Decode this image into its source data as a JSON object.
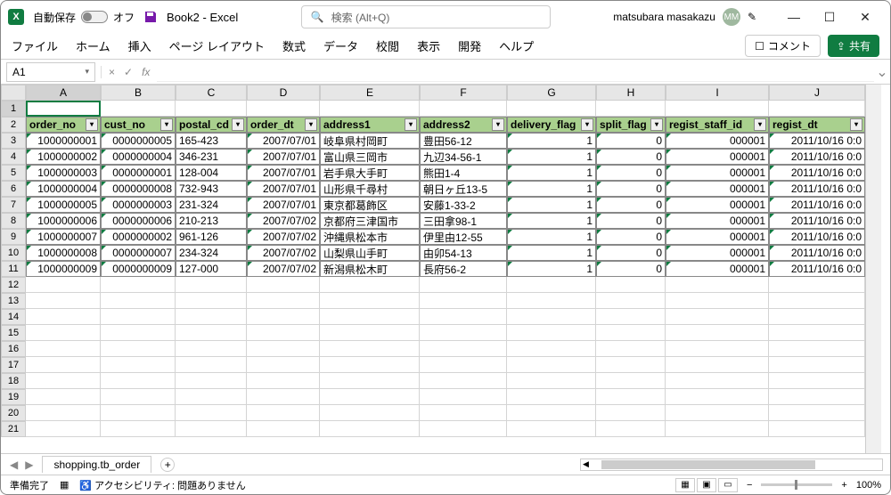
{
  "title_bar": {
    "autosave_label": "自動保存",
    "autosave_off": "オフ",
    "doc_title": "Book2 - Excel",
    "search_placeholder": "検索 (Alt+Q)",
    "user_name": "matsubara masakazu",
    "user_initials": "MM"
  },
  "ribbon": {
    "tabs": [
      "ファイル",
      "ホーム",
      "挿入",
      "ページ レイアウト",
      "数式",
      "データ",
      "校閲",
      "表示",
      "開発",
      "ヘルプ"
    ],
    "comment_label": "コメント",
    "share_label": "共有"
  },
  "formula_bar": {
    "name_box": "A1",
    "fx": "fx"
  },
  "columns": [
    "A",
    "B",
    "C",
    "D",
    "E",
    "F",
    "G",
    "H",
    "I",
    "J"
  ],
  "row_numbers": [
    1,
    2,
    3,
    4,
    5,
    6,
    7,
    8,
    9,
    10,
    11,
    12,
    13,
    14,
    15,
    16,
    17,
    18,
    19,
    20,
    21
  ],
  "headers": [
    "order_no",
    "cust_no",
    "postal_cd",
    "order_dt",
    "address1",
    "address2",
    "delivery_flag",
    "split_flag",
    "regist_staff_id",
    "regist_dt"
  ],
  "rows": [
    [
      "1000000001",
      "0000000005",
      "165-423",
      "2007/07/01",
      "岐阜県村岡町",
      "豊田56-12",
      "1",
      "0",
      "000001",
      "2011/10/16 0:0"
    ],
    [
      "1000000002",
      "0000000004",
      "346-231",
      "2007/07/01",
      "富山県三岡市",
      "九辺34-56-1",
      "1",
      "0",
      "000001",
      "2011/10/16 0:0"
    ],
    [
      "1000000003",
      "0000000001",
      "128-004",
      "2007/07/01",
      "岩手県大手町",
      "熊田1-4",
      "1",
      "0",
      "000001",
      "2011/10/16 0:0"
    ],
    [
      "1000000004",
      "0000000008",
      "732-943",
      "2007/07/01",
      "山形県千尋村",
      "朝日ヶ丘13-5",
      "1",
      "0",
      "000001",
      "2011/10/16 0:0"
    ],
    [
      "1000000005",
      "0000000003",
      "231-324",
      "2007/07/01",
      "東京都葛飾区",
      "安藤1-33-2",
      "1",
      "0",
      "000001",
      "2011/10/16 0:0"
    ],
    [
      "1000000006",
      "0000000006",
      "210-213",
      "2007/07/02",
      "京都府三津国市",
      "三田拿98-1",
      "1",
      "0",
      "000001",
      "2011/10/16 0:0"
    ],
    [
      "1000000007",
      "0000000002",
      "961-126",
      "2007/07/02",
      "沖縄県松本市",
      "伊里由12-55",
      "1",
      "0",
      "000001",
      "2011/10/16 0:0"
    ],
    [
      "1000000008",
      "0000000007",
      "234-324",
      "2007/07/02",
      "山梨県山手町",
      "由卯54-13",
      "1",
      "0",
      "000001",
      "2011/10/16 0:0"
    ],
    [
      "1000000009",
      "0000000009",
      "127-000",
      "2007/07/02",
      "新潟県松木町",
      "長府56-2",
      "1",
      "0",
      "000001",
      "2011/10/16 0:0"
    ]
  ],
  "right_align_cols": [
    0,
    1,
    3,
    6,
    7,
    8,
    9
  ],
  "sheet_tabs": {
    "active": "shopping.tb_order"
  },
  "status_bar": {
    "ready": "準備完了",
    "accessibility": "アクセシビリティ: 問題ありません",
    "zoom": "100%"
  }
}
